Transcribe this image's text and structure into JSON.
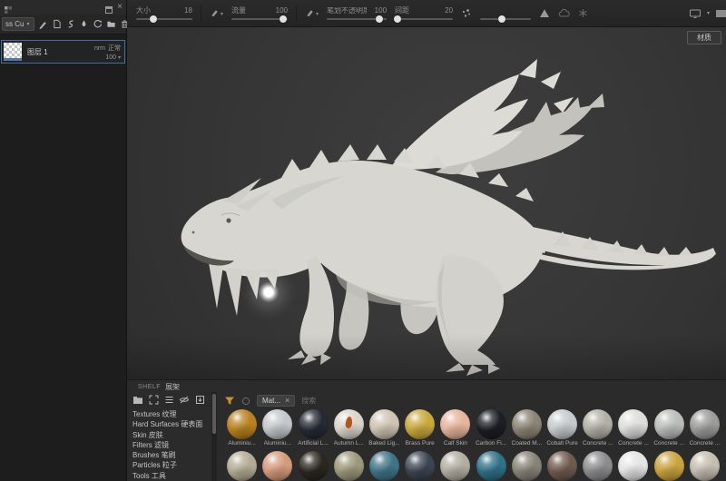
{
  "colors": {
    "accent_selection": "#3f6ea5",
    "funnel_yellow": "#c8932f",
    "viewport_bg": "#3a3a3a",
    "panel_bg": "#2b2b2b"
  },
  "icons": {
    "close": "×",
    "chevron_down": "▾",
    "dropdown_caret": "▾"
  },
  "layers_panel": {
    "mode_dropdown": "ss Cu",
    "layer": {
      "name": "图层 1",
      "blend_abbr": "nrm",
      "blend": "正常",
      "opacity": "100"
    }
  },
  "toolbar": {
    "sliders": [
      {
        "label": "大小",
        "value": "18"
      },
      {
        "label": "流量",
        "value": "100"
      },
      {
        "label": "笔划不透明度",
        "value": "100"
      },
      {
        "label": "间距",
        "value": "20"
      }
    ]
  },
  "viewport": {
    "material_button": "材质"
  },
  "shelf": {
    "title_en": "SHELF",
    "title_cn": "展架",
    "categories": [
      {
        "en": "Textures",
        "cn": "纹理"
      },
      {
        "en": "Hard Surfaces",
        "cn": "硬表面"
      },
      {
        "en": "Skin",
        "cn": "皮肤"
      },
      {
        "en": "Filters",
        "cn": "滤镜"
      },
      {
        "en": "Brushes",
        "cn": "笔刷"
      },
      {
        "en": "Particles",
        "cn": "粒子"
      },
      {
        "en": "Tools",
        "cn": "工具"
      }
    ],
    "filter": {
      "chip": "Mat...",
      "search_placeholder": "搜索"
    },
    "materials_row1": [
      {
        "name": "Aluminiu...",
        "color": "#b9821f"
      },
      {
        "name": "Aluminiu...",
        "color": "#c3c7cb"
      },
      {
        "name": "Artificial L...",
        "color": "#262a34"
      },
      {
        "name": "Autumn L...",
        "color": "#d9d5cb",
        "leaf": "#b5551d"
      },
      {
        "name": "Baked Lig...",
        "color": "#cfc3b2"
      },
      {
        "name": "Brass Pure",
        "color": "#c9a93e"
      },
      {
        "name": "Calf Skin",
        "color": "#e6b49c"
      },
      {
        "name": "Carbon Fi...",
        "color": "#1c1e24"
      },
      {
        "name": "Coated M...",
        "color": "#8b8374"
      },
      {
        "name": "Cobalt Pure",
        "color": "#c6cacd"
      },
      {
        "name": "Concrete ...",
        "color": "#b2b0a6"
      },
      {
        "name": "Concrete ...",
        "color": "#dddddb"
      },
      {
        "name": "Concrete ...",
        "color": "#babdb9"
      },
      {
        "name": "Concrete ...",
        "color": "#9b9b99"
      }
    ],
    "materials_row2": [
      {
        "color": "#b3ab93"
      },
      {
        "color": "#d49a7c"
      },
      {
        "color": "#2b2620"
      },
      {
        "color": "#9d987b"
      },
      {
        "color": "#3f7486"
      },
      {
        "color": "#3c4552"
      },
      {
        "color": "#b1ada1"
      },
      {
        "color": "#2f7188"
      },
      {
        "color": "#878378"
      },
      {
        "color": "#70594f"
      },
      {
        "color": "#8c8c8e"
      },
      {
        "color": "#e4e4e4"
      },
      {
        "color": "#c9a33e"
      },
      {
        "color": "#c4beb0"
      }
    ]
  }
}
